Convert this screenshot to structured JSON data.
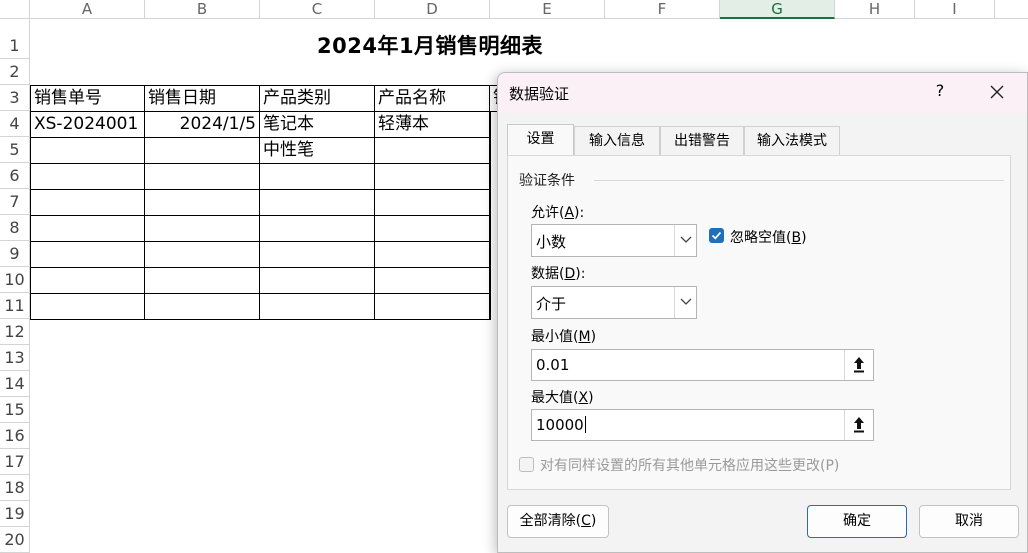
{
  "spreadsheet": {
    "columns": [
      "A",
      "B",
      "C",
      "D",
      "E",
      "F",
      "G",
      "H",
      "I"
    ],
    "active_column": "G",
    "rows": [
      "1",
      "2",
      "3",
      "4",
      "5",
      "6",
      "7",
      "8",
      "9",
      "10",
      "11",
      "12",
      "13",
      "14",
      "15",
      "16",
      "17",
      "18",
      "19",
      "20"
    ],
    "title": "2024年1月销售明细表",
    "headers": [
      "销售单号",
      "销售日期",
      "产品类别",
      "产品名称",
      "销"
    ],
    "cells": {
      "a4": "XS-2024001",
      "b4": "2024/1/5",
      "c4": "笔记本",
      "d4": "轻薄本",
      "c5": "中性笔"
    }
  },
  "dialog": {
    "title": "数据验证",
    "help": "?",
    "close": "✕",
    "tabs": [
      "设置",
      "输入信息",
      "出错警告",
      "输入法模式"
    ],
    "active_tab": "设置",
    "group_label": "验证条件",
    "allow": {
      "label": "允许",
      "accel": "A",
      "value": "小数"
    },
    "ignore_blank": {
      "label": "忽略空值",
      "accel": "B",
      "checked": true
    },
    "data": {
      "label": "数据",
      "accel": "D",
      "value": "介于"
    },
    "minimum": {
      "label": "最小值",
      "accel": "M",
      "value": "0.01"
    },
    "maximum": {
      "label": "最大值",
      "accel": "X",
      "value": "10000"
    },
    "apply_all": {
      "label": "对有同样设置的所有其他单元格应用这些更改(P)",
      "checked": false,
      "enabled": false
    },
    "clear_all": {
      "label": "全部清除",
      "accel": "C"
    },
    "ok": "确定",
    "cancel": "取消"
  },
  "colors": {
    "accent": "#1f6fb9",
    "active_column": "#1e7145",
    "titlebar": "#fbf0f6"
  }
}
